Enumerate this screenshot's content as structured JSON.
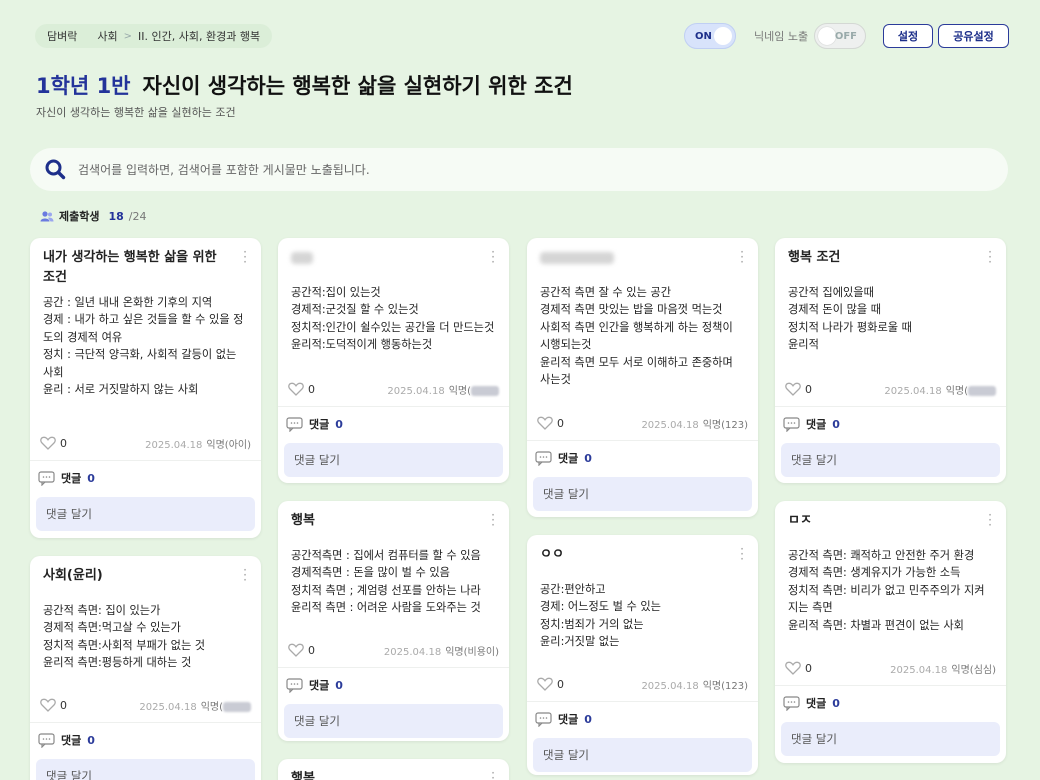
{
  "breadcrumb": {
    "root": "담벼락",
    "subject": "사회",
    "unit": "II. 인간, 사회, 환경과 행복"
  },
  "header": {
    "toggle_on_label": "ON",
    "nickname_label": "닉네임 노출",
    "toggle_off_label": "OFF",
    "settings_label": "설정",
    "share_label": "공유설정"
  },
  "class_name": "1학년 1반",
  "title": "자신이 생각하는 행복한 삶을 실현하기 위한 조건",
  "subtitle": "자신이 생각하는 행복한 삶을 실현하는 조건",
  "search": {
    "placeholder": "검색어를 입력하면, 검색어를 포함한 게시물만 노출됩니다."
  },
  "submit": {
    "label": "제출학생",
    "count": "18",
    "total": "/24"
  },
  "comment_label": "댓글",
  "comment_btn": "댓글 달기",
  "cards": {
    "c1": {
      "title": "내가 생각하는 행복한 삶을 위한 조건",
      "body": "공간 : 일년 내내 온화한 기후의 지역\n경제 : 내가 하고 싶은 것들을 할 수 있을 정도의 경제적 여유\n정치 : 극단적 양극화, 사회적 갈등이 없는 사회\n윤리 : 서로 거짓말하지 않는 사회",
      "likes": "0",
      "date": "2025.04.18",
      "author": "익명(아이)",
      "comments": "0"
    },
    "c2": {
      "title": "사회(윤리)",
      "body": "공간적 측면: 집이 있는가\n경제적 측면:먹고살 수 있는가\n정치적 측면:사회적 부패가 없는 것\n윤리적 측면:평등하게 대하는 것",
      "likes": "0",
      "date": "2025.04.18",
      "author": "익명(",
      "comments": "0"
    },
    "c3": {
      "title": "",
      "body": "공간적:집이 있는것\n경제적:군것질 할 수 있는것\n정치적:인간이 쉴수있는 공간을 더 만드는것\n윤리적:도덕적이게 행동하는것",
      "likes": "0",
      "date": "2025.04.18",
      "author": "익명(",
      "comments": "0"
    },
    "c4": {
      "title": "행복",
      "body": "공간적측면 : 집에서 컴퓨터를 할 수 있음\n경제적측면 : 돈을 많이 벌 수 있음\n정치적 측면 ; 계엄령 선포를 안하는 나라\n윤리적 측면 : 어려운 사람을 도와주는 것",
      "likes": "0",
      "date": "2025.04.18",
      "author": "익명(비용이)",
      "comments": "0"
    },
    "c5": {
      "title": "행복",
      "body": "",
      "likes": "",
      "date": "",
      "author": "",
      "comments": ""
    },
    "c6": {
      "title": "",
      "body": "공간적 측면 잘 수 있는 공간\n경제적 측면 맛있는 밥을 마음껏 먹는것\n사회적 측면 인간을 행복하게 하는 정책이 시행되는것\n윤리적 측면 모두 서로 이해하고 존중하며 사는것",
      "likes": "0",
      "date": "2025.04.18",
      "author": "익명(123)",
      "comments": "0"
    },
    "c7": {
      "title": "ㅇㅇ",
      "body": "공간:편안하고\n경제: 어느정도 벌 수 있는\n정치:범죄가 거의 없는\n윤리:거짓말 없는",
      "likes": "0",
      "date": "2025.04.18",
      "author": "익명(123)",
      "comments": "0"
    },
    "c8": {
      "title": "행복 조건",
      "body": "공간적 집에있을때\n경제적 돈이 많을 때\n정치적 나라가 평화로울 때\n윤리적",
      "likes": "0",
      "date": "2025.04.18",
      "author": "익명(",
      "comments": "0"
    },
    "c9": {
      "title": "ㅁㅈ",
      "body": "공간적 측면: 쾌적하고 안전한 주거 환경\n경제적 측면: 생계유지가 가능한 소득\n정치적 측면: 비리가 없고 민주주의가 지켜지는 측면\n윤리적 측면: 차별과 편견이 없는 사회",
      "likes": "0",
      "date": "2025.04.18",
      "author": "익명(심심)",
      "comments": "0"
    }
  },
  "colors": {
    "background": "#e6f4e3",
    "accent": "#23339a",
    "comment_button": "#eaedfb"
  }
}
